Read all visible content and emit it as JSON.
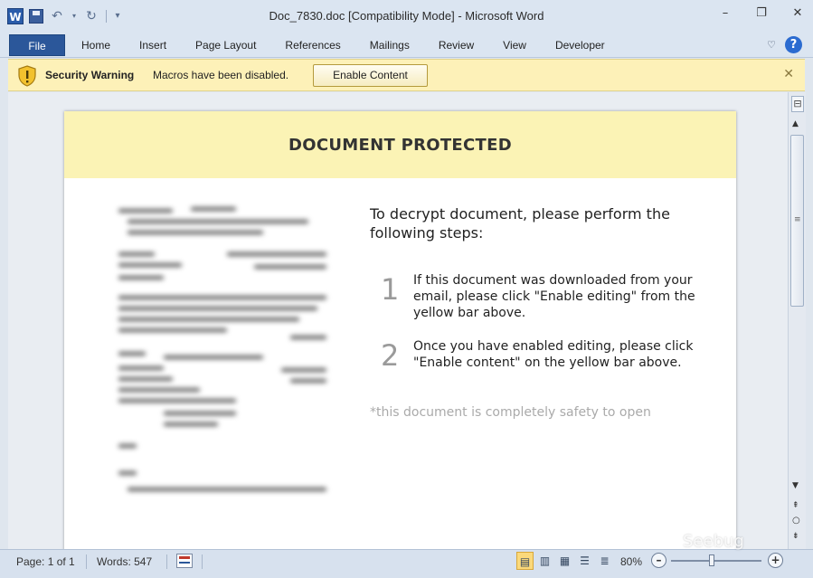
{
  "window": {
    "title": "Doc_7830.doc [Compatibility Mode]  -  Microsoft Word",
    "app_icon": "W",
    "controls": [
      "minimize-icon",
      "restore-icon",
      "close-icon"
    ]
  },
  "ribbon": {
    "file_label": "File",
    "tabs": [
      "Home",
      "Insert",
      "Page Layout",
      "References",
      "Mailings",
      "Review",
      "View",
      "Developer"
    ],
    "help_label": "?"
  },
  "security_bar": {
    "title": "Security Warning",
    "message": "Macros have been disabled.",
    "button_label": "Enable Content",
    "close_label": "✕",
    "accent_color": "#fdf1b8"
  },
  "document": {
    "heading": "DOCUMENT PROTECTED",
    "instruction": "To decrypt document, please perform the following steps:",
    "steps": [
      {
        "number": "1",
        "text": "If this document was downloaded from your email, please click \"Enable editing\" from the yellow bar above."
      },
      {
        "number": "2",
        "text": "Once you have enabled editing, please click \"Enable content\" on the yellow bar above."
      }
    ],
    "note": "*this document is completely safety to open"
  },
  "status_bar": {
    "page": "Page: 1 of 1",
    "words": "Words: 547",
    "zoom": "80%",
    "zoom_fraction": 0.45
  },
  "watermark": "Seebug"
}
